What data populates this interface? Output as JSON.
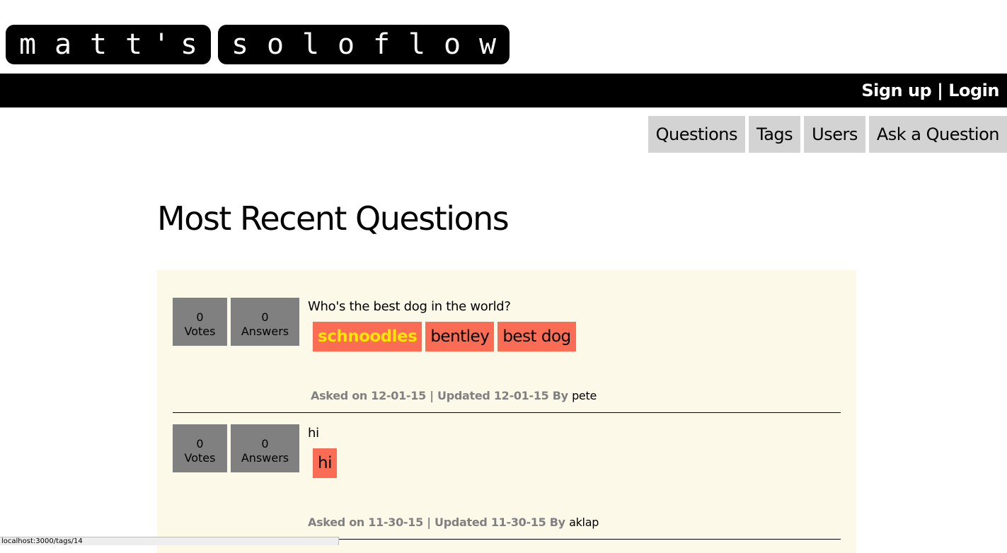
{
  "logo": {
    "chunks": [
      [
        "m",
        "a",
        "t",
        "t",
        "'",
        "s"
      ],
      [
        "s",
        "o",
        "l",
        "o",
        "f",
        "l",
        "o",
        "w"
      ]
    ]
  },
  "header": {
    "signup": "Sign up",
    "separator": " | ",
    "login": "Login"
  },
  "nav": {
    "questions": "Questions",
    "tags": "Tags",
    "users": "Users",
    "ask": "Ask a Question"
  },
  "page": {
    "title": "Most Recent Questions"
  },
  "questions": [
    {
      "votes": "0",
      "votes_label": "Votes",
      "answers": "0",
      "answers_label": "Answers",
      "title": "Who's the best dog in the world?",
      "tags": [
        "schnoodles",
        "bentley",
        "best dog"
      ],
      "meta": "Asked on 12-01-15 | Updated 12-01-15 By ",
      "author": "pete"
    },
    {
      "votes": "0",
      "votes_label": "Votes",
      "answers": "0",
      "answers_label": "Answers",
      "title": "hi",
      "tags": [
        "hi"
      ],
      "meta": "Asked on 11-30-15 | Updated 11-30-15 By ",
      "author": "aklap"
    }
  ],
  "statusbar": {
    "url": "localhost:3000/tags/14"
  },
  "colors": {
    "tag_bg": "#fa6d54",
    "tag_highlight_text": "#ffe600",
    "panel_bg": "#fdf9e9",
    "stat_bg": "#808080",
    "nav_bg": "#d3d3d3"
  }
}
